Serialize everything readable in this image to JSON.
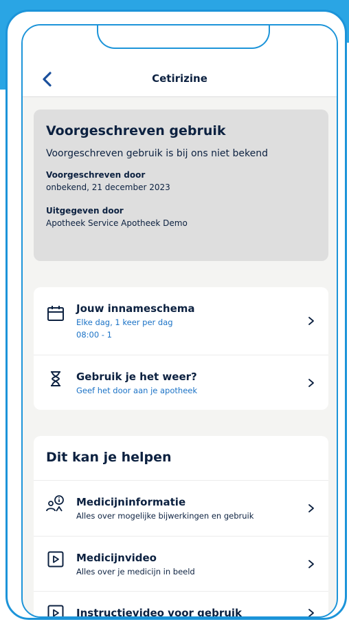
{
  "header": {
    "title": "Cetirizine"
  },
  "usage": {
    "heading": "Voorgeschreven gebruik",
    "description": "Voorgeschreven gebruik is bij ons niet bekend",
    "prescribed_by_label": "Voorgeschreven door",
    "prescribed_by_value": "onbekend, 21 december 2023",
    "issued_by_label": "Uitgegeven door",
    "issued_by_value": "Apotheek Service Apotheek Demo"
  },
  "schedule": {
    "title": "Jouw innameschema",
    "line1": "Elke dag, 1 keer per dag",
    "line2": "08:00 - 1"
  },
  "reuse": {
    "title": "Gebruik je het weer?",
    "subtitle": "Geef het door aan je apotheek"
  },
  "help": {
    "heading": "Dit kan je helpen",
    "items": [
      {
        "title": "Medicijninformatie",
        "subtitle": "Alles over mogelijke bijwerkingen en gebruik"
      },
      {
        "title": "Medicijnvideo",
        "subtitle": "Alles over je medicijn in beeld"
      },
      {
        "title": "Instructievideo voor gebruik",
        "subtitle": ""
      }
    ]
  },
  "colors": {
    "accent": "#1c94d9",
    "link": "#1a72c6",
    "text": "#0c2140"
  },
  "icons": {
    "back": "chevron-left-icon",
    "calendar": "calendar-icon",
    "hourglass": "hourglass-icon",
    "info_person": "person-info-icon",
    "video": "play-video-icon",
    "chevron": "chevron-right-icon"
  }
}
